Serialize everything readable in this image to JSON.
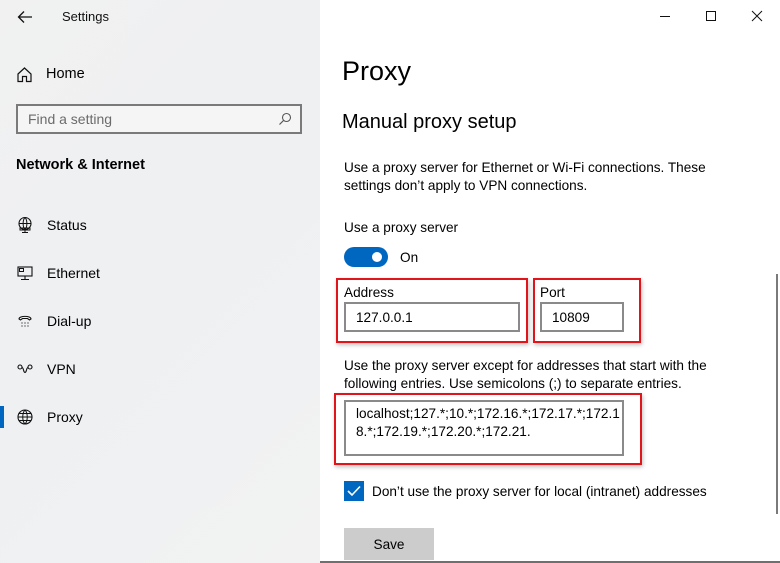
{
  "app": {
    "title": "Settings"
  },
  "window_controls": {
    "minimize_icon": "minimize-icon",
    "maximize_icon": "maximize-icon",
    "close_icon": "close-icon"
  },
  "sidebar": {
    "home_label": "Home",
    "search_placeholder": "Find a setting",
    "section_title": "Network & Internet",
    "items": [
      {
        "label": "Status",
        "icon": "status-globe-monitor-icon",
        "active": false
      },
      {
        "label": "Ethernet",
        "icon": "ethernet-icon",
        "active": false
      },
      {
        "label": "Dial-up",
        "icon": "dialup-phone-icon",
        "active": false
      },
      {
        "label": "VPN",
        "icon": "vpn-icon",
        "active": false
      },
      {
        "label": "Proxy",
        "icon": "globe-icon",
        "active": true
      }
    ]
  },
  "main": {
    "page_title": "Proxy",
    "section_heading": "Manual proxy setup",
    "description": "Use a proxy server for Ethernet or Wi-Fi connections. These settings don’t apply to VPN connections.",
    "use_proxy_label": "Use a proxy server",
    "use_proxy_state": "On",
    "address_label": "Address",
    "address_value": "127.0.0.1",
    "port_label": "Port",
    "port_value": "10809",
    "exceptions_description": "Use the proxy server except for addresses that start with the following entries. Use semicolons (;) to separate entries.",
    "exceptions_value": "localhost;127.*;10.*;172.16.*;172.17.*;172.18.*;172.19.*;172.20.*;172.21.",
    "local_bypass_label": "Don’t use the proxy server for local (intranet) addresses",
    "local_bypass_checked": true,
    "save_label": "Save"
  },
  "colors": {
    "accent": "#0067c0",
    "highlight": "#e0141b"
  }
}
